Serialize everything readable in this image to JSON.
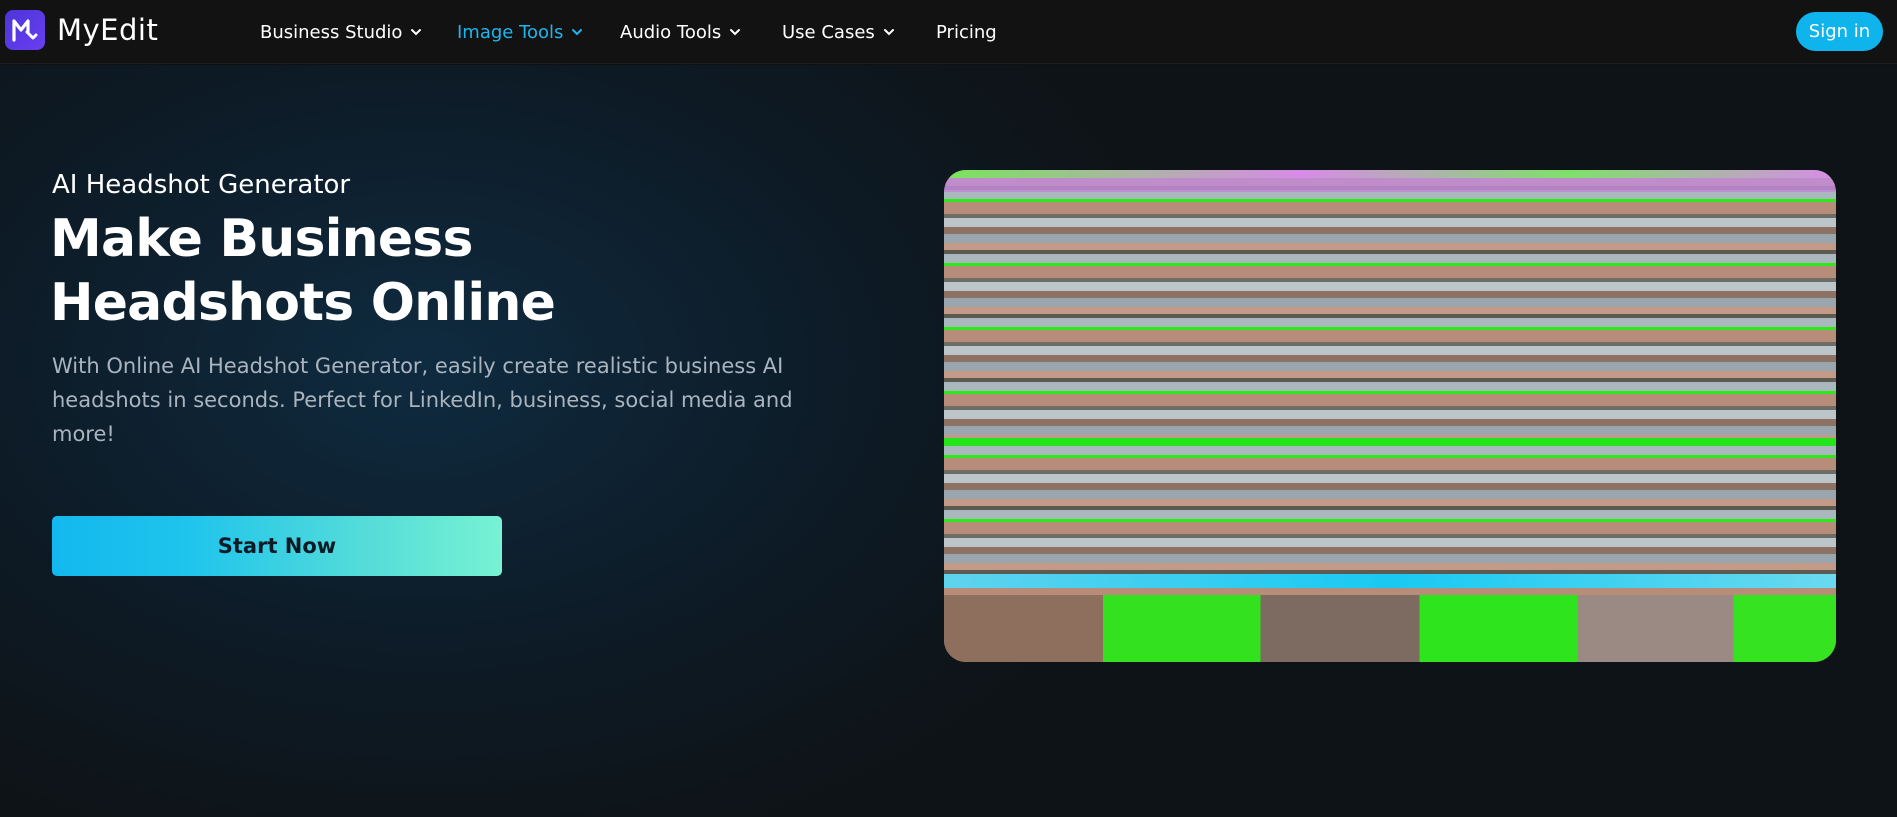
{
  "brand": {
    "name": "MyEdit",
    "logo_color": "#4b35d8"
  },
  "nav": {
    "items": [
      {
        "label": "Business Studio",
        "has_dropdown": true,
        "active": false
      },
      {
        "label": "Image Tools",
        "has_dropdown": true,
        "active": true
      },
      {
        "label": "Audio Tools",
        "has_dropdown": true,
        "active": false
      },
      {
        "label": "Use Cases",
        "has_dropdown": true,
        "active": false
      },
      {
        "label": "Pricing",
        "has_dropdown": false,
        "active": false
      }
    ],
    "active_color": "#1fb6ee"
  },
  "auth": {
    "signin_label": "Sign in",
    "signin_color": "#0fb4ec"
  },
  "hero": {
    "eyebrow": "AI Headshot Generator",
    "headline": "Make Business Headshots Online",
    "description": "With Online AI Headshot Generator, easily create realistic business AI headshots in seconds. Perfect for LinkedIn, business, social media and more!",
    "cta_label": "Start Now"
  },
  "media": {
    "alt": "headshot-preview-image"
  }
}
